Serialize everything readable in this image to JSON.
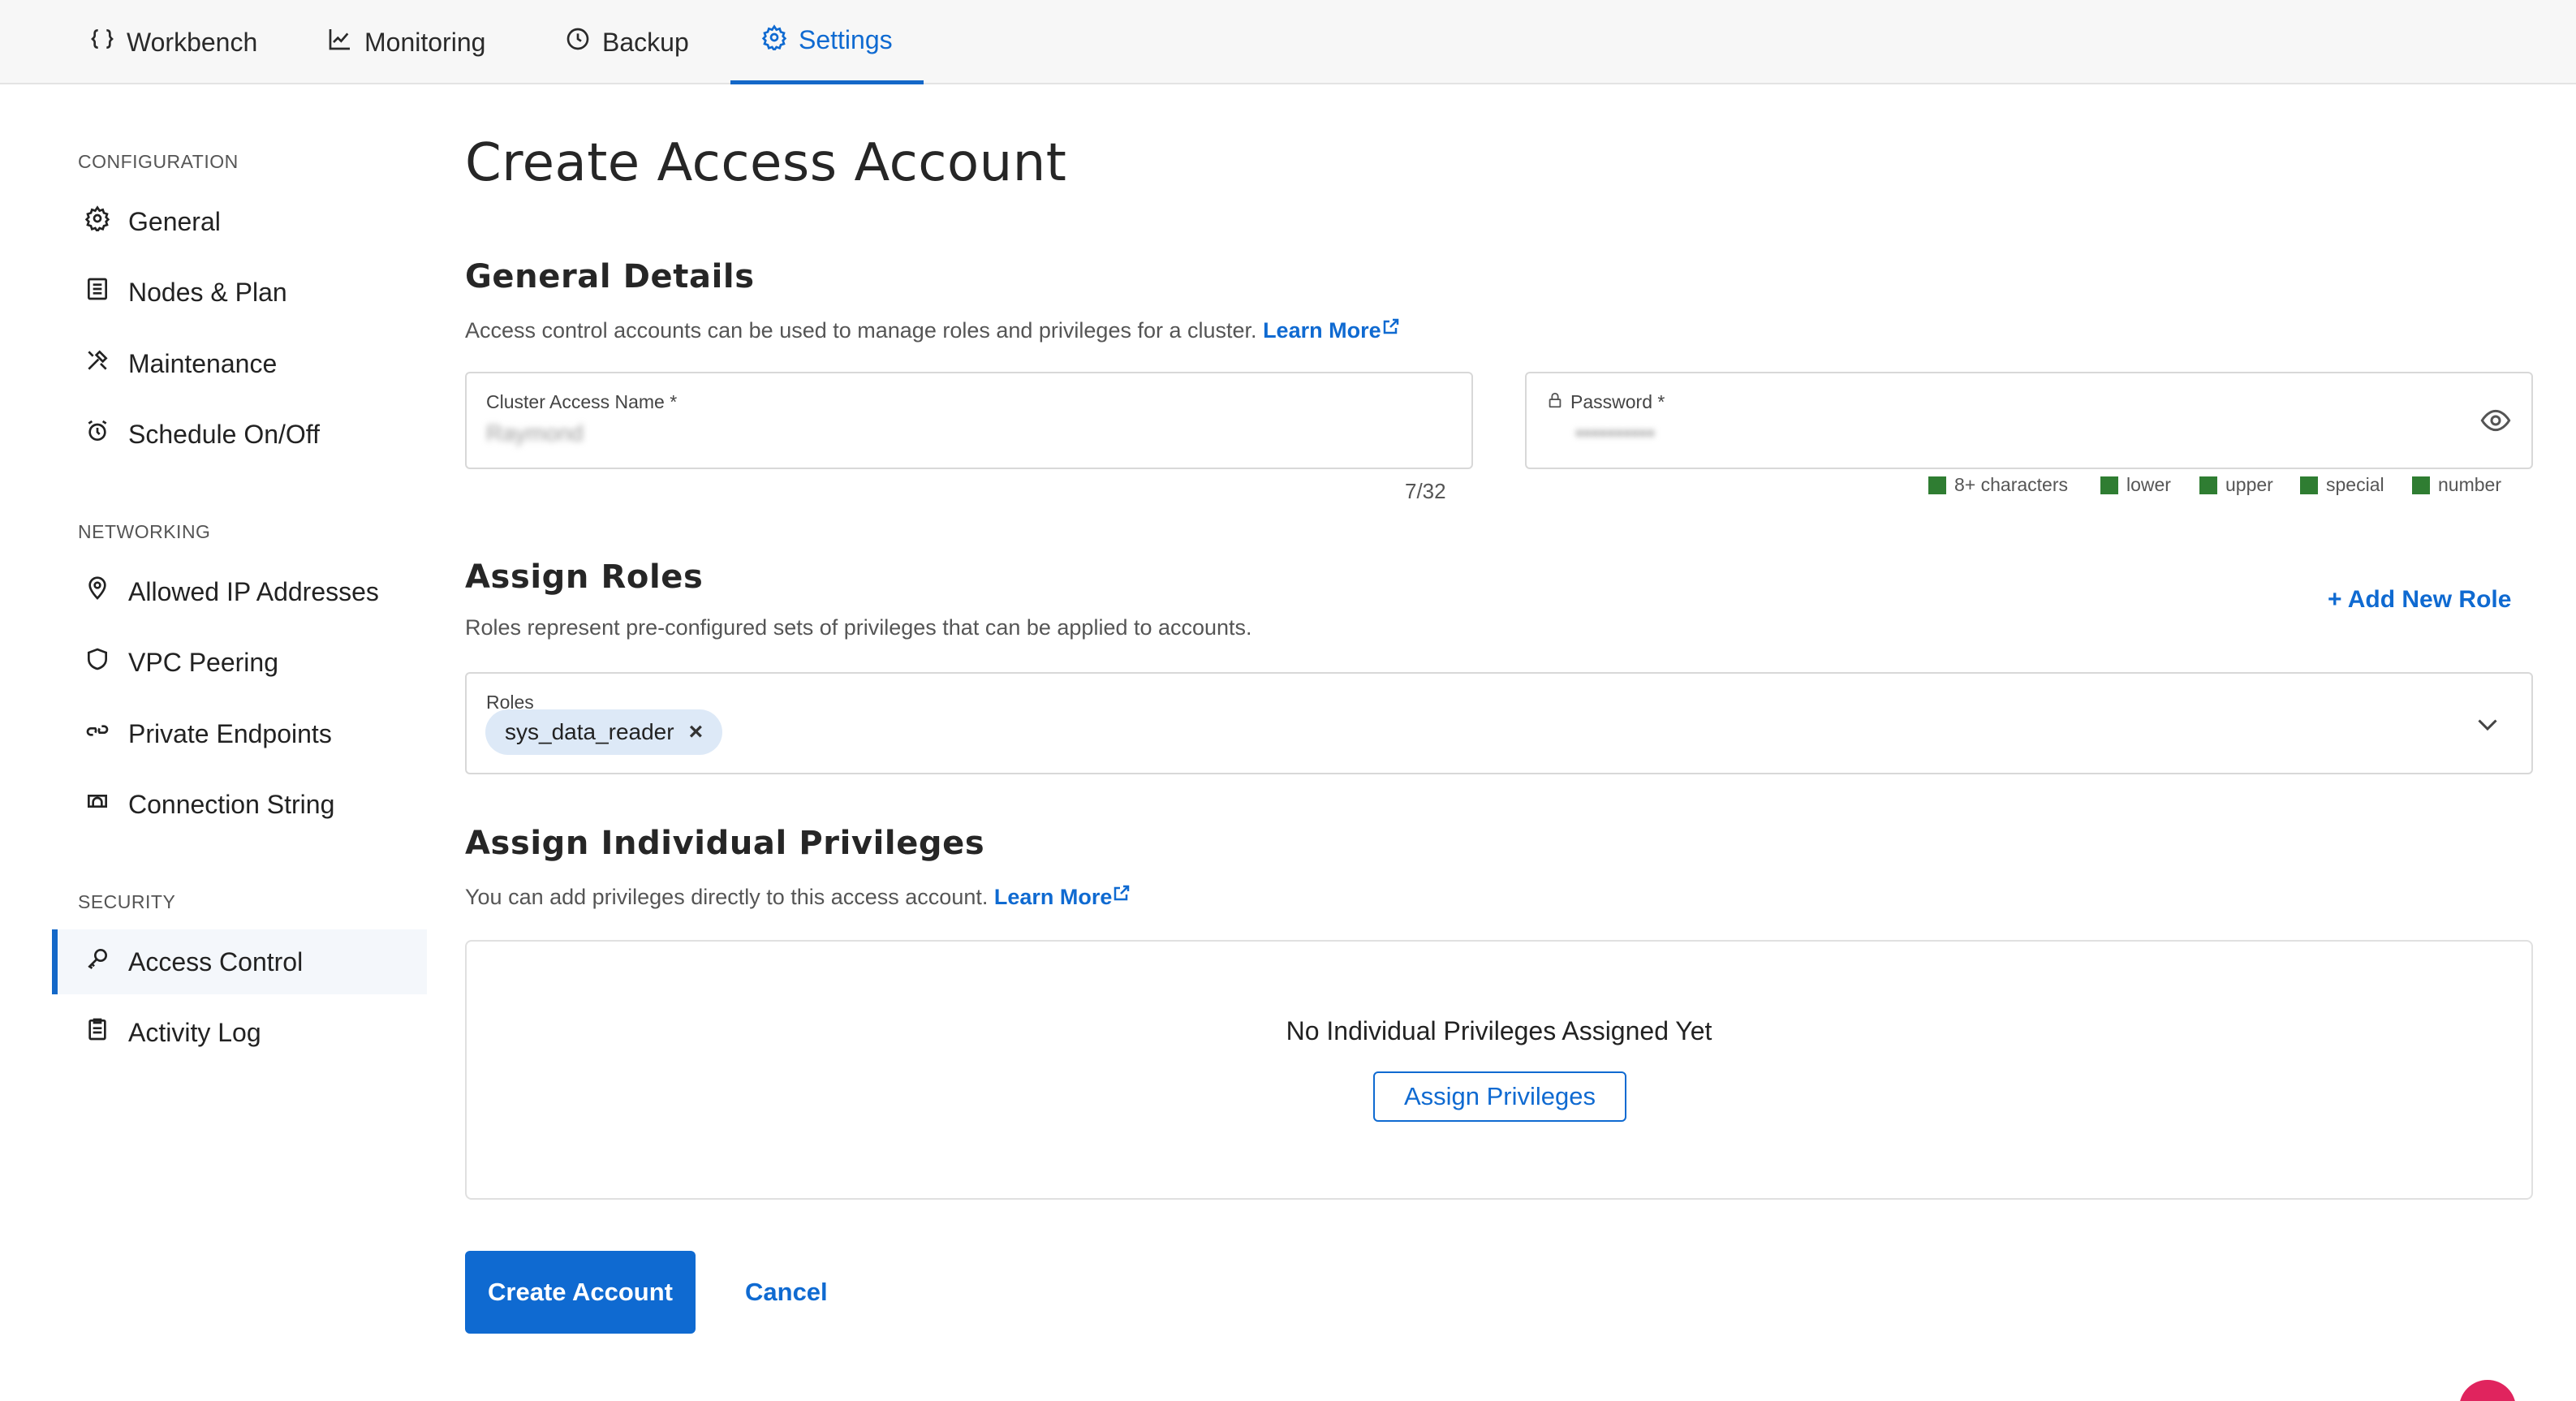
{
  "topnav": {
    "tabs": [
      {
        "label": "Workbench",
        "icon": "braces-icon"
      },
      {
        "label": "Monitoring",
        "icon": "line-chart-icon"
      },
      {
        "label": "Backup",
        "icon": "clock-icon"
      },
      {
        "label": "Settings",
        "icon": "gear-icon",
        "active": true
      }
    ]
  },
  "sidebar": {
    "sections": [
      {
        "heading": "CONFIGURATION",
        "items": [
          {
            "label": "General",
            "icon": "gear-icon"
          },
          {
            "label": "Nodes & Plan",
            "icon": "list-icon"
          },
          {
            "label": "Maintenance",
            "icon": "tools-icon"
          },
          {
            "label": "Schedule On/Off",
            "icon": "alarm-clock-icon"
          }
        ]
      },
      {
        "heading": "NETWORKING",
        "items": [
          {
            "label": "Allowed IP Addresses",
            "icon": "location-pin-icon"
          },
          {
            "label": "VPC Peering",
            "icon": "shield-icon"
          },
          {
            "label": "Private Endpoints",
            "icon": "link-icon"
          },
          {
            "label": "Connection String",
            "icon": "bridge-icon"
          }
        ]
      },
      {
        "heading": "SECURITY",
        "items": [
          {
            "label": "Access Control",
            "icon": "key-icon",
            "active": true
          },
          {
            "label": "Activity Log",
            "icon": "clipboard-icon"
          }
        ]
      }
    ]
  },
  "page": {
    "title": "Create Access Account"
  },
  "general": {
    "title": "General Details",
    "description": "Access control accounts can be used to manage roles and privileges for a cluster.",
    "learn_more": "Learn More",
    "name_label": "Cluster Access Name *",
    "name_value": "Raymond",
    "name_counter": "7/32",
    "password_label": "Password *",
    "password_value": "••••••••••",
    "strength": [
      "8+ characters",
      "lower",
      "upper",
      "special",
      "number"
    ],
    "strength_color": "#2f7d32"
  },
  "roles": {
    "title": "Assign Roles",
    "description": "Roles represent pre-configured sets of privileges that can be applied to accounts.",
    "add_label": "+ Add New Role",
    "field_label": "Roles",
    "selected": [
      "sys_data_reader"
    ],
    "chip_remove": "×"
  },
  "privileges": {
    "title": "Assign Individual Privileges",
    "description": "You can add privileges directly to this access account.",
    "learn_more": "Learn More",
    "empty_text": "No Individual Privileges Assigned Yet",
    "assign_button": "Assign Privileges"
  },
  "actions": {
    "create": "Create Account",
    "cancel": "Cancel"
  },
  "colors": {
    "accent": "#0f6ad1",
    "chip_bg": "#dde9f7"
  }
}
